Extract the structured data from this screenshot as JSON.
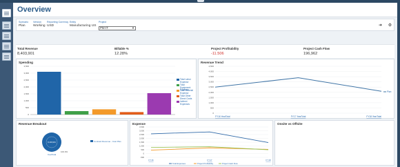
{
  "app": {
    "title": "Overview"
  },
  "sidebar": {
    "items": [
      "dashboard-icon",
      "forms-icon",
      "reports-icon",
      "analysis-icon",
      "tasks-icon"
    ]
  },
  "pov": [
    {
      "label": "Scenario",
      "value": "Plan"
    },
    {
      "label": "Version",
      "value": "Working"
    },
    {
      "label": "Reporting Currency",
      "value": "USD"
    },
    {
      "label": "Entity",
      "value": "Manufacturing US"
    },
    {
      "label": "Project",
      "value": "PM-IT"
    }
  ],
  "toolbar": {
    "go_icon": "arrow-right-icon",
    "settings_icon": "gear-icon"
  },
  "kpis": [
    {
      "label": "Total Revenue",
      "value": "8,403,901"
    },
    {
      "label": "Billable %",
      "value": "12.28%"
    },
    {
      "label": "Project Profitability",
      "value": "-11.506"
    },
    {
      "label": "Project Cash Flow",
      "value": "196,962"
    }
  ],
  "colors": {
    "accent": "#2b6cb0",
    "negative": "#d0312d",
    "line": "#3f74a6"
  },
  "chart_data": [
    {
      "type": "bar",
      "title": "Spending",
      "categories": [
        "Total Labor Expense",
        "Total Equipment Expense",
        "Total Material Expense",
        "Total Other Direct Costs",
        "Indirect Expenses"
      ],
      "values": [
        3100,
        250,
        380,
        180,
        1550
      ],
      "colors": [
        "#2065a8",
        "#3fa049",
        "#f39a2a",
        "#e25d1a",
        "#9b3ab0"
      ],
      "ylim": [
        0,
        3500
      ],
      "yticks": [
        "3,500",
        "3,000",
        "2,500",
        "2,000",
        "1,500",
        "1,000",
        "500",
        "0"
      ],
      "legend": [
        "Total Labor Expense",
        "Total Equipment Expense",
        "Total Material Expense",
        "Total Other Direct Costs",
        "Indirect Expenses"
      ]
    },
    {
      "type": "line",
      "title": "Revenue Trend",
      "x": [
        "FY16 YearTotal",
        "FY17 YearTotal",
        "FY18 YearTotal"
      ],
      "series": [
        {
          "name": "Plan",
          "values": [
            2500,
            3400,
            2100
          ]
        }
      ],
      "ylim": [
        0,
        4500
      ],
      "yticks": [
        "4,500",
        "4,000",
        "3,500",
        "3,000",
        "2,500",
        "2,000",
        "1,500",
        "1,000",
        "500",
        "0"
      ]
    },
    {
      "type": "pie",
      "title": "Revenue Breakout",
      "slices": [
        {
          "name": "Contract Revenue - Cost Plus",
          "value": 100
        }
      ],
      "center_label": "8,403,901",
      "footer": "YearTotal",
      "percent_label": "100.0%"
    },
    {
      "type": "line",
      "title": "Expense",
      "x": [
        "FY16",
        "FY17",
        "FY18"
      ],
      "series": [
        {
          "name": "Total Expenses",
          "values": [
            2600,
            2850,
            1450
          ]
        },
        {
          "name": "Project Profitability",
          "values": [
            450,
            750,
            550
          ]
        },
        {
          "name": "Project Cash Flow",
          "values": [
            800,
            900,
            500
          ]
        }
      ],
      "series_colors": [
        "#2f69a8",
        "#f39a2a",
        "#9cc45a"
      ],
      "ylim": [
        -500,
        3500
      ],
      "yticks": [
        "3,500",
        "3,000",
        "2,500",
        "2,000",
        "1,500",
        "1,000",
        "500",
        "0",
        "-500"
      ]
    }
  ],
  "panels": {
    "onsite_title": "Onsite vs Offsite"
  }
}
